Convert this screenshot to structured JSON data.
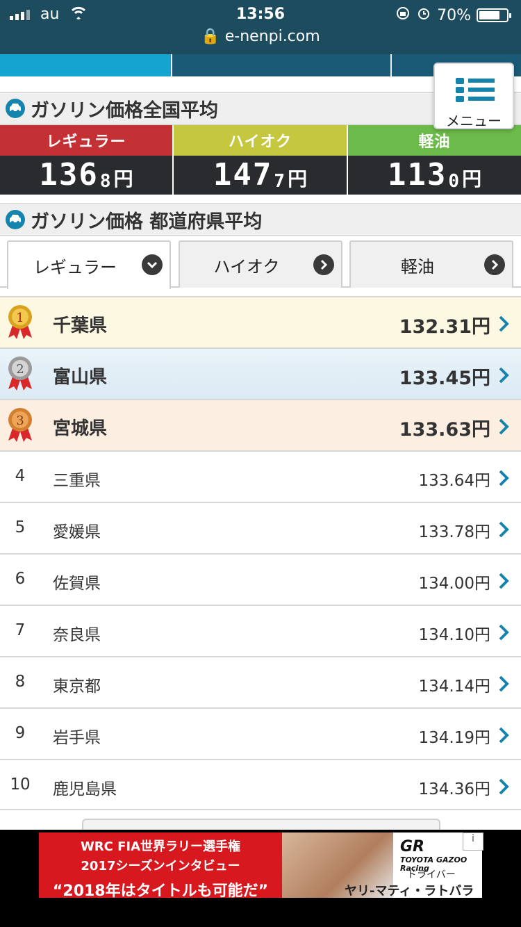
{
  "status_bar": {
    "carrier": "au",
    "time": "13:56",
    "battery": "70%",
    "url": "e-nenpi.com"
  },
  "menu": {
    "label": "メニュー"
  },
  "national_average": {
    "title": "ガソリン価格全国平均",
    "items": [
      {
        "label": "レギュラー",
        "integer": "136",
        "decimal": "8",
        "unit": "円",
        "color": "#c43134"
      },
      {
        "label": "ハイオク",
        "integer": "147",
        "decimal": "7",
        "unit": "円",
        "color": "#c5c73e"
      },
      {
        "label": "軽油",
        "integer": "113",
        "decimal": "0",
        "unit": "円",
        "color": "#6cbb4a"
      }
    ]
  },
  "prefecture_average": {
    "title": "ガソリン価格 都道府県平均",
    "tabs": [
      {
        "label": "レギュラー",
        "active": true
      },
      {
        "label": "ハイオク",
        "active": false
      },
      {
        "label": "軽油",
        "active": false
      }
    ],
    "ranking": [
      {
        "rank": "1",
        "name": "千葉県",
        "price": "132.31円"
      },
      {
        "rank": "2",
        "name": "富山県",
        "price": "133.45円"
      },
      {
        "rank": "3",
        "name": "宮城県",
        "price": "133.63円"
      },
      {
        "rank": "4",
        "name": "三重県",
        "price": "133.64円"
      },
      {
        "rank": "5",
        "name": "愛媛県",
        "price": "133.78円"
      },
      {
        "rank": "6",
        "name": "佐賀県",
        "price": "134.00円"
      },
      {
        "rank": "7",
        "name": "奈良県",
        "price": "134.10円"
      },
      {
        "rank": "8",
        "name": "東京都",
        "price": "134.14円"
      },
      {
        "rank": "9",
        "name": "岩手県",
        "price": "134.19円"
      },
      {
        "rank": "10",
        "name": "鹿児島県",
        "price": "134.36円"
      }
    ]
  },
  "ad": {
    "line1": "WRC FIA世界ラリー選手権",
    "line2": "2017シーズンインタビュー",
    "line3": "“2018年はタイトルも可能だ”",
    "brand": "GR",
    "brand_small": "TOYOTA GAZOO Racing",
    "role": "ドライバー",
    "driver": "ヤリ-マティ・ラトバラ",
    "info": "i"
  },
  "colors": {
    "accent": "#0b8ab3",
    "chevron": "#1584ad",
    "gold": "#d9a21f",
    "silver": "#9a9a9a",
    "bronze": "#d2802f"
  }
}
